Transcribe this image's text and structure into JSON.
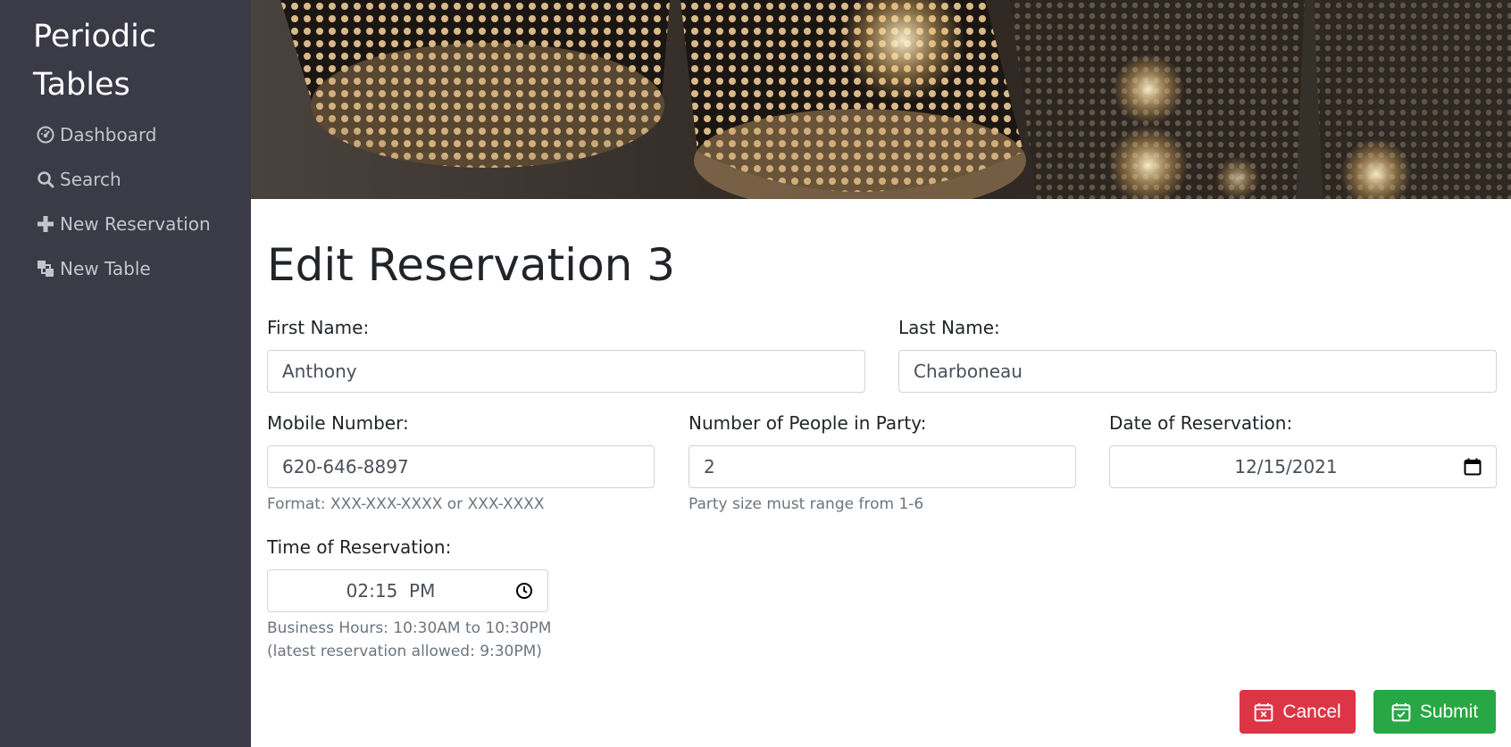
{
  "sidebar": {
    "brand": "Periodic Tables",
    "items": [
      {
        "label": "Dashboard",
        "icon": "dashboard-icon"
      },
      {
        "label": "Search",
        "icon": "search-icon"
      },
      {
        "label": "New Reservation",
        "icon": "plus-icon"
      },
      {
        "label": "New Table",
        "icon": "tables-icon"
      }
    ]
  },
  "page": {
    "title": "Edit Reservation 3"
  },
  "form": {
    "first_name": {
      "label": "First Name:",
      "value": "Anthony"
    },
    "last_name": {
      "label": "Last Name:",
      "value": "Charboneau"
    },
    "mobile": {
      "label": "Mobile Number:",
      "value": "620-646-8897",
      "help": "Format: XXX-XXX-XXXX or XXX-XXXX"
    },
    "people": {
      "label": "Number of People in Party:",
      "value": "2",
      "help": "Party size must range from 1-6"
    },
    "date": {
      "label": "Date of Reservation:",
      "value": "12/15/2021"
    },
    "time": {
      "label": "Time of Reservation:",
      "value": "02:15  PM",
      "help_line1": "Business Hours: 10:30AM to 10:30PM",
      "help_line2": "(latest reservation allowed: 9:30PM)"
    }
  },
  "buttons": {
    "cancel": "Cancel",
    "submit": "Submit"
  },
  "colors": {
    "sidebar_bg": "#3b3a47",
    "cancel": "#dc3545",
    "submit": "#28a745"
  }
}
